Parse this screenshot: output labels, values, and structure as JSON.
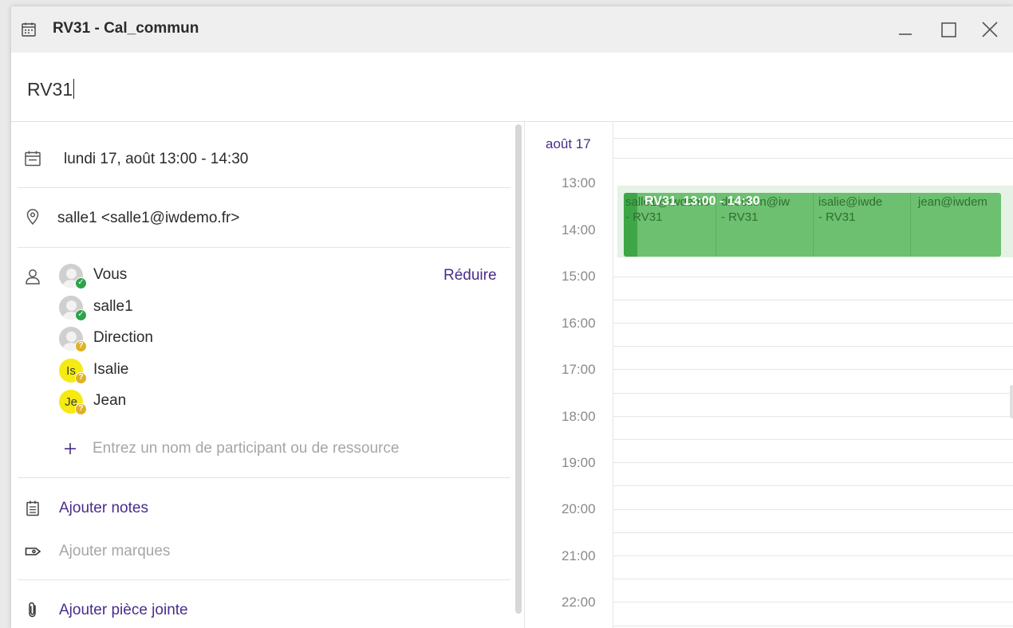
{
  "window": {
    "title": "RV31 - Cal_commun",
    "icon": "calendar-icon",
    "controls": [
      "minimize-icon",
      "maximize-icon",
      "close-icon"
    ]
  },
  "subject": {
    "value": "RV31"
  },
  "details": {
    "datetime": "lundi 17, août 13:00 - 14:30",
    "location": "salle1 <salle1@iwdemo.fr>",
    "collapse_label": "Réduire",
    "attendees": [
      {
        "name": "Vous",
        "avatar": "person",
        "status": "accepted"
      },
      {
        "name": "salle1",
        "avatar": "person",
        "status": "accepted"
      },
      {
        "name": "Direction",
        "avatar": "person",
        "status": "pending"
      },
      {
        "name": "Isalie",
        "avatar": "initials",
        "initials": "Is",
        "status": "pending"
      },
      {
        "name": "Jean",
        "avatar": "initials",
        "initials": "Je",
        "status": "pending"
      }
    ],
    "add_participant_placeholder": "Entrez un nom de participant ou de ressource",
    "add_notes": "Ajouter notes",
    "add_tags": "Ajouter marques",
    "add_attachment": "Ajouter pièce jointe"
  },
  "calendar": {
    "day_label": "août 17",
    "hours": [
      "13:00",
      "14:00",
      "15:00",
      "16:00",
      "17:00",
      "18:00",
      "19:00",
      "20:00",
      "21:00",
      "22:00"
    ],
    "event": {
      "title": "RV31",
      "time": "13:00 - 14:30",
      "columns": [
        {
          "line1": "salle1@iwdemo",
          "line2": "- RV31"
        },
        {
          "line1": "direction@iw",
          "line2": "- RV31"
        },
        {
          "line1": "isalie@iwde",
          "line2": "- RV31"
        },
        {
          "line1": "jean@iwdem",
          "line2": ""
        }
      ]
    }
  },
  "colors": {
    "accent": "#4a2c8a",
    "event_green": "#6cc06f",
    "status_accepted": "#2fa34a",
    "status_pending": "#dfb223",
    "initials_avatar": "#f5ea11"
  }
}
